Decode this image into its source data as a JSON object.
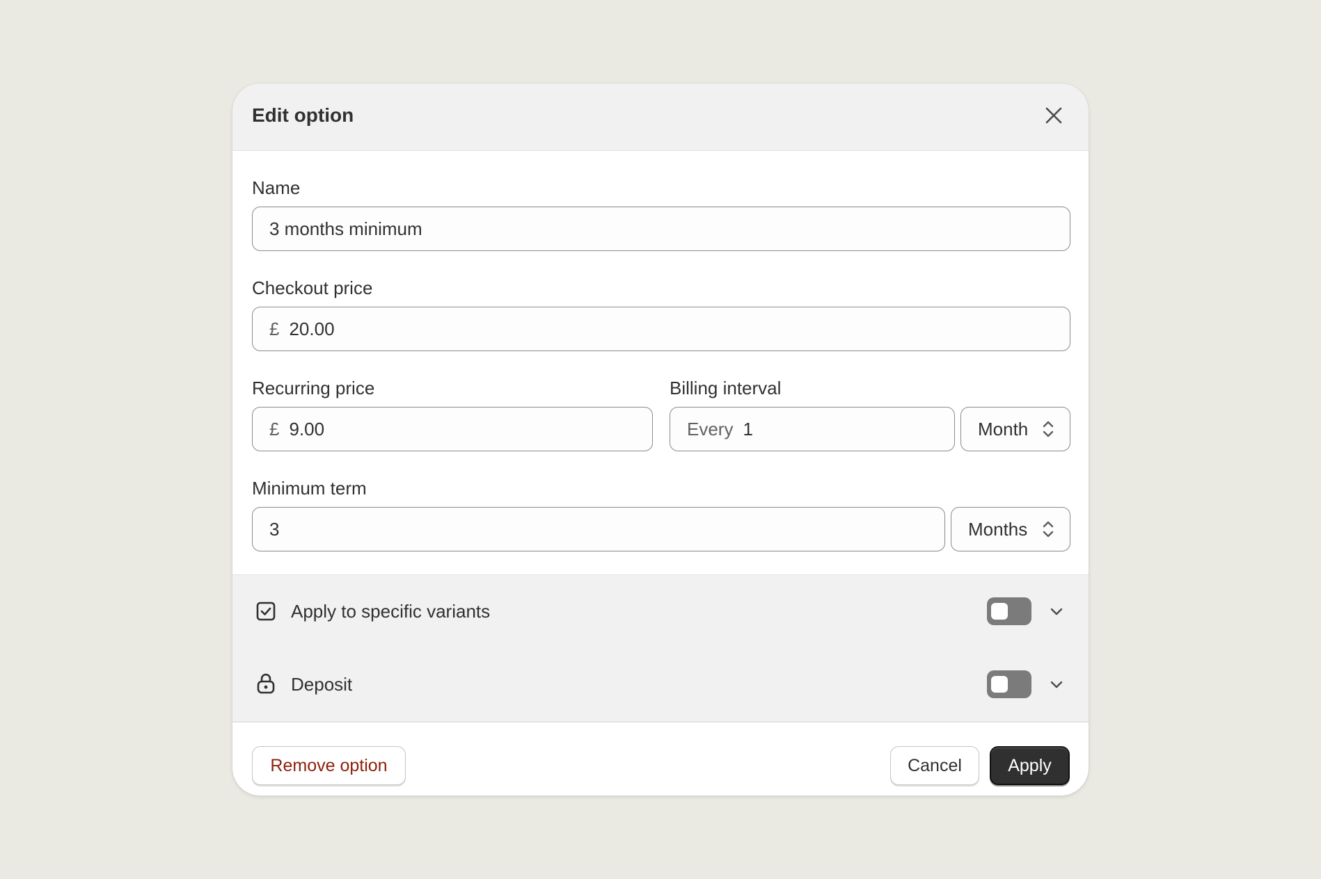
{
  "modal": {
    "title": "Edit option",
    "close_icon": "close-icon"
  },
  "form": {
    "name": {
      "label": "Name",
      "value": "3 months minimum"
    },
    "checkout_price": {
      "label": "Checkout price",
      "currency": "£",
      "value": "20.00"
    },
    "recurring_price": {
      "label": "Recurring price",
      "currency": "£",
      "value": "9.00"
    },
    "billing_interval": {
      "label": "Billing interval",
      "prefix": "Every",
      "value": "1",
      "unit": "Month",
      "unit_icon": "chevron-up-down-icon"
    },
    "minimum_term": {
      "label": "Minimum term",
      "value": "3",
      "unit": "Months",
      "unit_icon": "chevron-up-down-icon"
    }
  },
  "sections": [
    {
      "label": "Apply to specific variants",
      "icon": "checkbox-icon",
      "toggle_on": false,
      "expand_icon": "chevron-down-icon"
    },
    {
      "label": "Deposit",
      "icon": "lock-icon",
      "toggle_on": false,
      "expand_icon": "chevron-down-icon"
    }
  ],
  "footer": {
    "remove_label": "Remove option",
    "cancel_label": "Cancel",
    "apply_label": "Apply"
  },
  "colors": {
    "background": "#eae9e2",
    "header": "#f1f1f1",
    "destructive_text": "#8e1f0b",
    "primary_button": "#303030",
    "toggle_off": "#7b7b7b"
  }
}
